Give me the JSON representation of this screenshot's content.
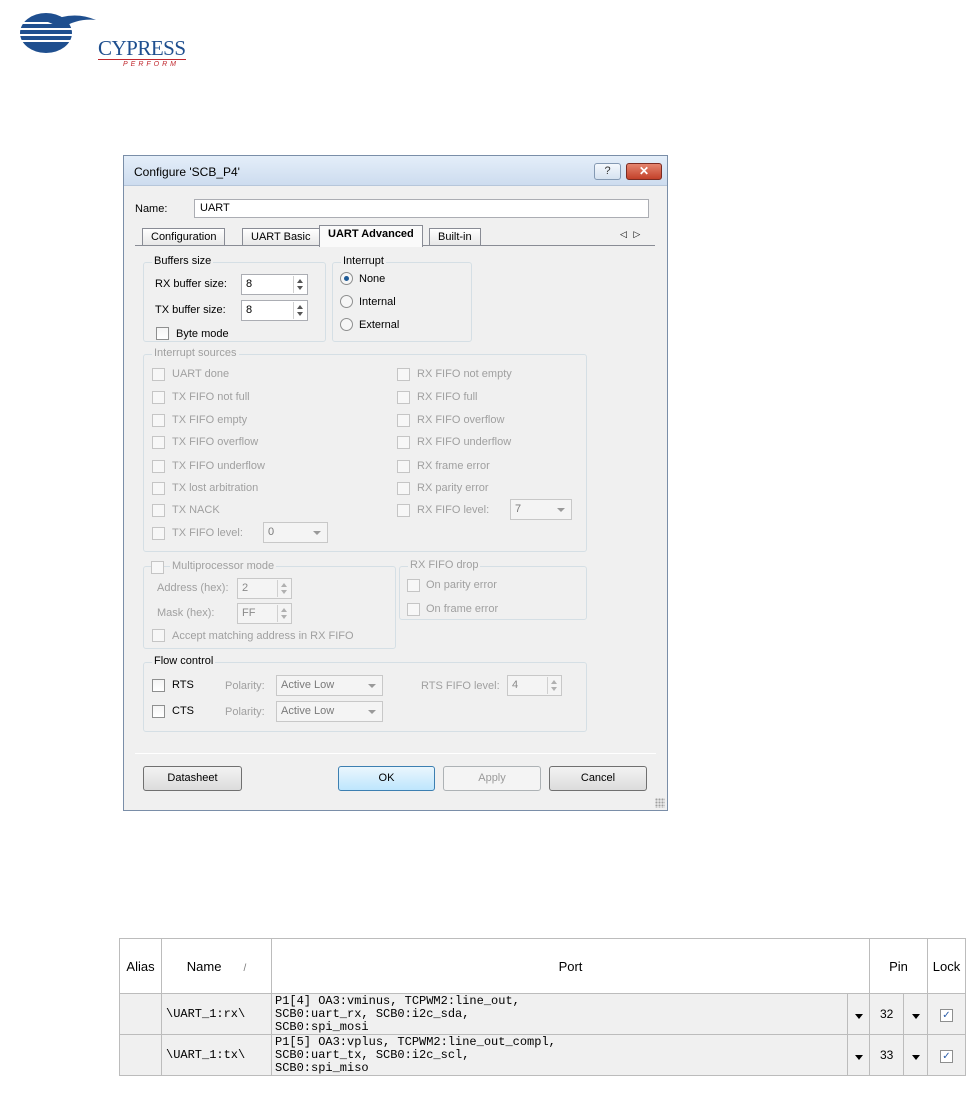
{
  "logo": {
    "wordmark": "CYPRESS",
    "tagline": "PERFORM"
  },
  "dialog": {
    "title": "Configure 'SCB_P4'",
    "help_label": "?",
    "close_label": "✕",
    "name_label": "Name:",
    "name_value": "UART",
    "tabs": [
      "Configuration",
      "UART Basic",
      "UART Advanced",
      "Built-in"
    ],
    "active_tab": "UART Advanced",
    "tab_scroll_arrows": "◁ ▷"
  },
  "buffers": {
    "title": "Buffers size",
    "rx_label": "RX buffer size:",
    "rx_value": "8",
    "tx_label": "TX buffer size:",
    "tx_value": "8",
    "byte_mode_label": "Byte mode"
  },
  "interrupt": {
    "title": "Interrupt",
    "options": [
      "None",
      "Internal",
      "External"
    ],
    "selected": "None"
  },
  "interrupt_sources": {
    "title": "Interrupt sources",
    "left": [
      "UART done",
      "TX FIFO not full",
      "TX FIFO empty",
      "TX FIFO overflow",
      "TX FIFO underflow",
      "TX lost arbitration",
      "TX NACK"
    ],
    "tx_fifo_level_label": "TX FIFO level:",
    "tx_fifo_level_value": "0",
    "right": [
      "RX FIFO not empty",
      "RX FIFO full",
      "RX FIFO overflow",
      "RX FIFO underflow",
      "RX frame error",
      "RX parity error"
    ],
    "rx_fifo_level_label": "RX FIFO level:",
    "rx_fifo_level_value": "7"
  },
  "multiprocessor": {
    "title": "Multiprocessor mode",
    "address_label": "Address (hex):",
    "address_value": "2",
    "mask_label": "Mask (hex):",
    "mask_value": "FF",
    "accept_label": "Accept matching address in RX FIFO"
  },
  "rx_fifo_drop": {
    "title": "RX FIFO drop",
    "parity_label": "On parity error",
    "frame_label": "On frame error"
  },
  "flow_control": {
    "title": "Flow control",
    "rts_label": "RTS",
    "cts_label": "CTS",
    "polarity_label": "Polarity:",
    "rts_polarity": "Active Low",
    "cts_polarity": "Active Low",
    "rts_fifo_level_label": "RTS FIFO level:",
    "rts_fifo_level_value": "4"
  },
  "buttons": {
    "datasheet": "Datasheet",
    "ok": "OK",
    "apply": "Apply",
    "cancel": "Cancel"
  },
  "pin_table": {
    "headers": {
      "alias": "Alias",
      "name": "Name",
      "sort_indicator": "/",
      "port": "Port",
      "pin": "Pin",
      "lock": "Lock"
    },
    "rows": [
      {
        "alias": "",
        "name": "\\UART_1:rx\\",
        "port": "P1[4] OA3:vminus, TCPWM2:line_out,\nSCB0:uart_rx, SCB0:i2c_sda,\nSCB0:spi_mosi",
        "pin": "32",
        "lock": "✓"
      },
      {
        "alias": "",
        "name": "\\UART_1:tx\\",
        "port": "P1[5] OA3:vplus, TCPWM2:line_out_compl,\nSCB0:uart_tx, SCB0:i2c_scl,\nSCB0:spi_miso",
        "pin": "33",
        "lock": "✓"
      }
    ]
  }
}
